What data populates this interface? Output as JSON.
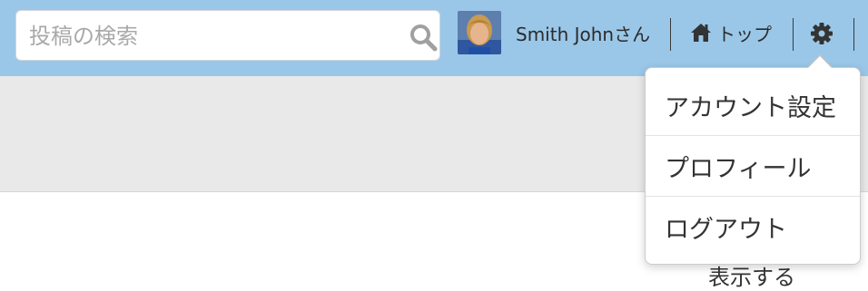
{
  "search": {
    "placeholder": "投稿の検索",
    "value": "",
    "icon": "search-icon"
  },
  "user": {
    "name": "Smith Johnさん",
    "avatar": "user-avatar"
  },
  "nav": {
    "home_label": "トップ",
    "home_icon": "home-icon",
    "settings_icon": "gear-icon"
  },
  "dropdown": {
    "items": [
      {
        "label": "アカウント設定"
      },
      {
        "label": "プロフィール"
      },
      {
        "label": "ログアウト"
      }
    ]
  },
  "footer": {
    "clipped_text": "表示する"
  },
  "colors": {
    "topbar": "#9ac7e8",
    "band": "#e9e9e9",
    "text": "#333333"
  }
}
